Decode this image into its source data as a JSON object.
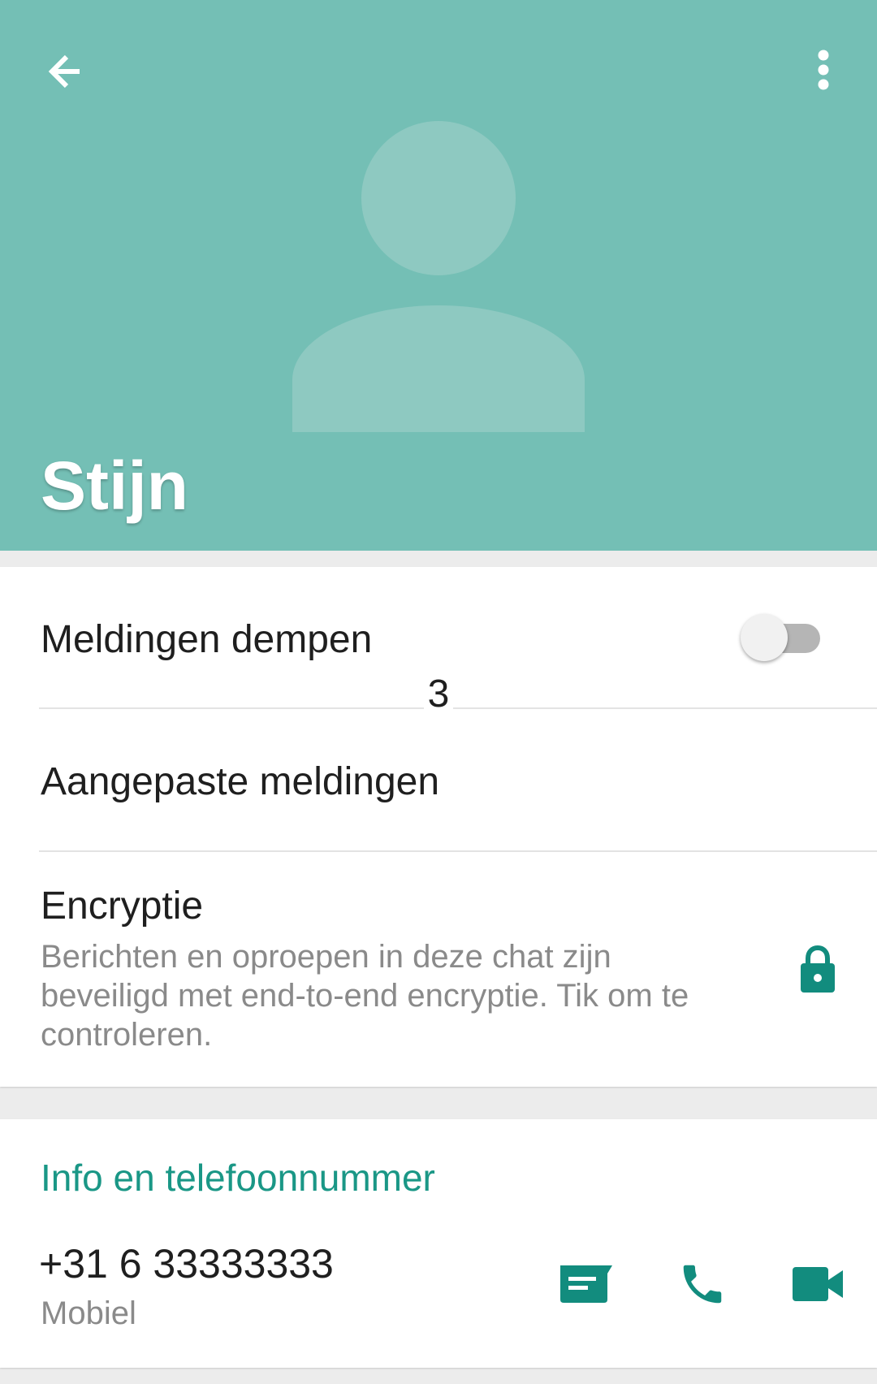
{
  "header": {
    "contact_name": "Stijn",
    "background_color": "#74bfb5",
    "icons": [
      "arrow-back-icon",
      "more-vert-icon",
      "default-avatar-icon"
    ]
  },
  "settings": {
    "mute_label": "Meldingen dempen",
    "mute_enabled": false,
    "count_badge": "3",
    "custom_notifications_label": "Aangepaste meldingen",
    "encryption_title": "Encryptie",
    "encryption_description": "Berichten en oproepen in deze chat zijn beveiligd met end-to-end encryptie. Tik om te controleren.",
    "encryption_icon": "lock-icon"
  },
  "info": {
    "section_title": "Info en telefoonnummer",
    "phone_number": "+31 6 33333333",
    "phone_type": "Mobiel",
    "actions": [
      "message-icon",
      "call-icon",
      "video-call-icon"
    ],
    "accent_color": "#128c7e"
  }
}
